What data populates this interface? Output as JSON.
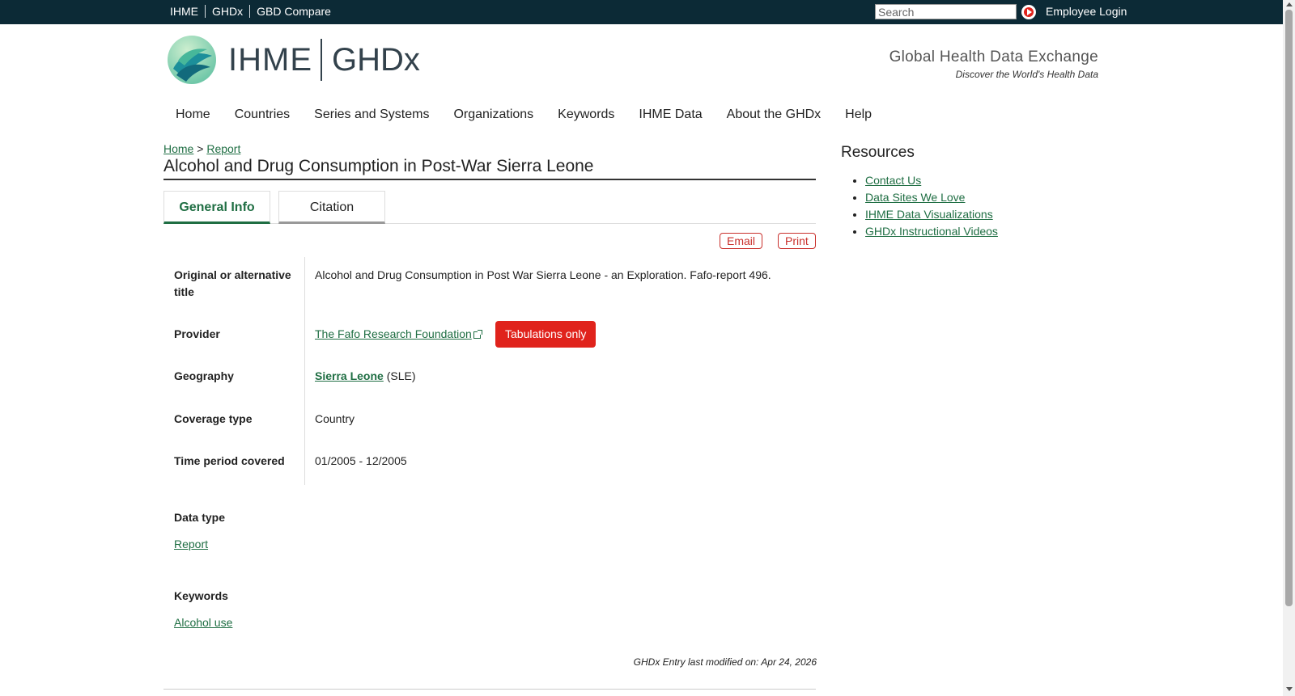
{
  "top_links": [
    "IHME",
    "GHDx",
    "GBD Compare"
  ],
  "search": {
    "placeholder": "Search"
  },
  "employee_login": "Employee Login",
  "brand": {
    "ihme": "IHME",
    "ghdx": "GHDx",
    "tagline_title": "Global Health Data Exchange",
    "tagline_sub": "Discover the World's Health Data"
  },
  "nav": [
    "Home",
    "Countries",
    "Series and Systems",
    "Organizations",
    "Keywords",
    "IHME Data",
    "About the GHDx",
    "Help"
  ],
  "breadcrumb": {
    "home": "Home",
    "sep": ">",
    "report": "Report"
  },
  "page_title": "Alcohol and Drug Consumption in Post-War Sierra Leone",
  "tabs": {
    "general": "General Info",
    "citation": "Citation"
  },
  "actions": {
    "email": "Email",
    "print": "Print"
  },
  "fields": {
    "orig_title_label": "Original or alternative title",
    "orig_title_value": "Alcohol and Drug Consumption in Post War Sierra Leone - an Exploration. Fafo-report 496.",
    "provider_label": "Provider",
    "provider_value": "The Fafo Research Foundation",
    "provider_badge": "Tabulations only",
    "geography_label": "Geography",
    "geography_link": "Sierra Leone",
    "geography_code": "(SLE)",
    "coverage_label": "Coverage type",
    "coverage_value": "Country",
    "time_label": "Time period covered",
    "time_value": "01/2005 - 12/2005",
    "datatype_label": "Data type",
    "datatype_value": "Report",
    "keywords_label": "Keywords",
    "keywords_value": "Alcohol use"
  },
  "footer_note": "GHDx Entry last modified on: Apr 24, 2026",
  "resources": {
    "title": "Resources",
    "items": [
      "Contact Us",
      "Data Sites We Love",
      "IHME Data Visualizations",
      "GHDx Instructional Videos"
    ]
  },
  "colors": {
    "topbar": "#0c2a36",
    "link": "#1f6e43",
    "accent_red": "#e0231c"
  }
}
